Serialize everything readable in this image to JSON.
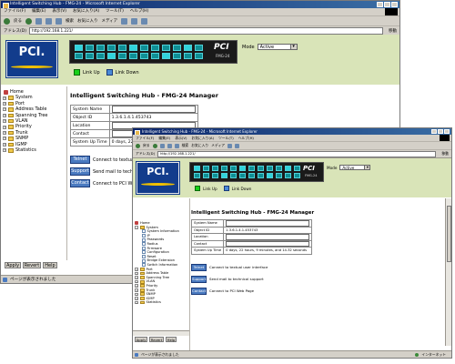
{
  "window": {
    "title": "Intelligent Switching Hub - FMG-24 - Microsoft Internet Explorer",
    "menu": [
      "ファイル(F)",
      "編集(E)",
      "表示(V)",
      "お気に入り(A)",
      "ツール(T)",
      "ヘルプ(H)"
    ],
    "toolbar": {
      "back": "戻る",
      "search": "検索",
      "favorites": "お気に入り",
      "media": "メディア"
    },
    "address_label": "アドレス(D)",
    "address": "http://192.168.1.221/",
    "go": "移動",
    "status_text": "ページが表示されました",
    "zone": "インターネット"
  },
  "header": {
    "logo": "PCI.",
    "device_brand": "PCI",
    "device_model": "FMG-24",
    "legend_link_up": "Link Up",
    "legend_link_down": "Link Down",
    "mode_label": "Mode",
    "mode_value": "Active"
  },
  "tree_back": [
    "Home",
    "System",
    "Port",
    "Address Table",
    "Spanning Tree",
    "VLAN",
    "Priority",
    "Trunk",
    "SNMP",
    "IGMP",
    "Statistics"
  ],
  "tree_front": [
    {
      "label": "Home",
      "icon": "home",
      "level": 0
    },
    {
      "label": "System",
      "icon": "folder-open",
      "level": 0
    },
    {
      "label": "System Information",
      "icon": "doc",
      "level": 1
    },
    {
      "label": "IP",
      "icon": "doc",
      "level": 1
    },
    {
      "label": "Passwords",
      "icon": "doc",
      "level": 1
    },
    {
      "label": "Radius",
      "icon": "doc",
      "level": 1
    },
    {
      "label": "Firmware",
      "icon": "doc",
      "level": 1
    },
    {
      "label": "Configuration",
      "icon": "doc",
      "level": 1
    },
    {
      "label": "Reset",
      "icon": "doc",
      "level": 1
    },
    {
      "label": "Bridge Extension",
      "icon": "doc",
      "level": 1
    },
    {
      "label": "Switch Information",
      "icon": "doc",
      "level": 1
    },
    {
      "label": "Port",
      "icon": "folder",
      "level": 0
    },
    {
      "label": "Address Table",
      "icon": "folder",
      "level": 0
    },
    {
      "label": "Spanning Tree",
      "icon": "folder",
      "level": 0
    },
    {
      "label": "VLAN",
      "icon": "folder",
      "level": 0
    },
    {
      "label": "Priority",
      "icon": "folder",
      "level": 0
    },
    {
      "label": "Trunk",
      "icon": "folder",
      "level": 0
    },
    {
      "label": "SNMP",
      "icon": "folder",
      "level": 0
    },
    {
      "label": "IGMP",
      "icon": "folder",
      "level": 0
    },
    {
      "label": "Statistics",
      "icon": "folder",
      "level": 0
    }
  ],
  "page": {
    "title": "Intelligent Switching Hub - FMG-24 Manager",
    "rows": [
      {
        "label": "System Name",
        "value": ""
      },
      {
        "label": "Object ID",
        "value": "1.3.6.1.4.1.453743"
      },
      {
        "label": "Location",
        "value": ""
      },
      {
        "label": "Contact",
        "value": ""
      },
      {
        "label": "System Up Time",
        "value": "0 days, 22 hours, 9 minutes, and 14.32 seconds"
      }
    ],
    "back_rows": [
      {
        "label": "System Name",
        "value": ""
      },
      {
        "label": "Object ID",
        "value": "1.3.6.1.4.1.453743"
      },
      {
        "label": "Location",
        "value": ""
      },
      {
        "label": "Contact",
        "value": ""
      },
      {
        "label": "System Up Time",
        "value": "0 days, 22 ho"
      }
    ],
    "actions": [
      {
        "button": "Telnet",
        "text": "Connect to textual user interface"
      },
      {
        "button": "Support",
        "text": "Send mail to technical support"
      },
      {
        "button": "Contact",
        "text": "Connect to PCI Web Page"
      }
    ],
    "back_actions": [
      {
        "button": "Telnet",
        "text": "Connect to textual"
      },
      {
        "button": "Support",
        "text": "Send mail to tech"
      },
      {
        "button": "Contact",
        "text": "Connect to PCI W"
      }
    ]
  },
  "buttons": {
    "apply": "Apply",
    "revert": "Revert",
    "help": "Help"
  },
  "colors": {
    "banner": "#d9e4b8",
    "titlebar": "#0a246a",
    "link_up": "#18d018",
    "link_down": "#4a8ad8",
    "port": "#0f8f95"
  }
}
